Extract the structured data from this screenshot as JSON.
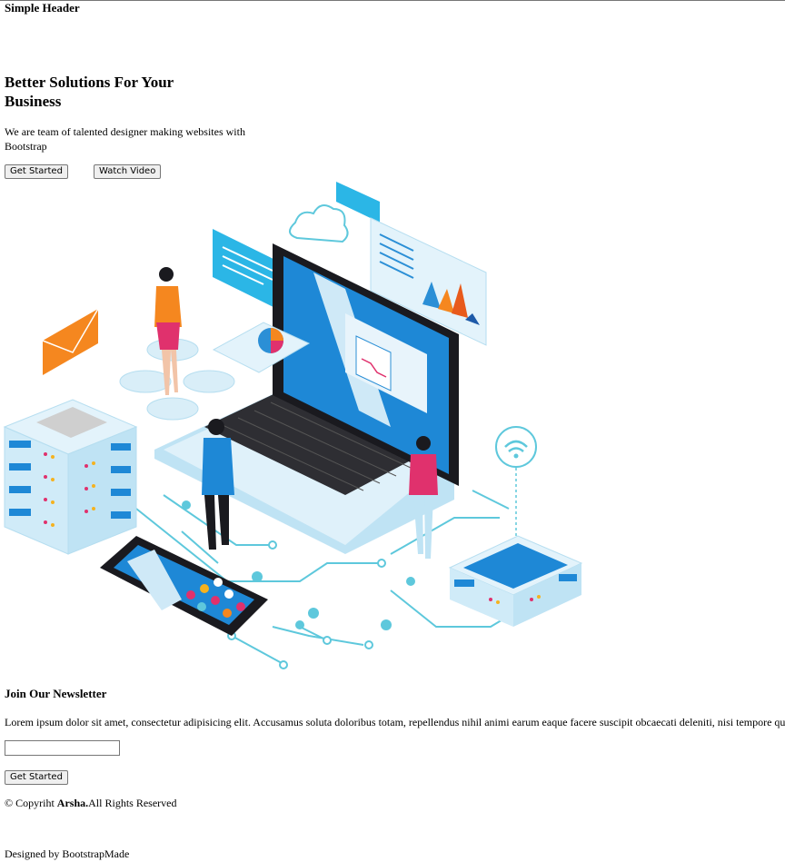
{
  "header": {
    "brand": "Simple Header"
  },
  "hero": {
    "title": "Better Solutions For Your Business",
    "subtitle": "We are team of talented designer making websites with Bootstrap",
    "get_started_label": "Get Started",
    "watch_video_label": "Watch Video",
    "illustration_icon": "laptop-network-illustration"
  },
  "newsletter": {
    "title": "Join Our Newsletter",
    "text": "Lorem ipsum dolor sit amet, consectetur adipisicing elit. Accusamus soluta doloribus totam, repellendus nihil animi earum eaque facere suscipit obcaecati deleniti, nisi tempore quo",
    "email_value": "",
    "submit_label": "Get Started"
  },
  "footer": {
    "copyright_prefix": "© Copyriht",
    "company": "Arsha.",
    "copyright_suffix": "All Rights Reserved",
    "credits": "Designed by BootstrapMade"
  },
  "colors": {
    "accent_blue": "#1e88d6",
    "light_blue": "#cfe9f7",
    "orange": "#f5871f",
    "pink": "#e0316d"
  }
}
